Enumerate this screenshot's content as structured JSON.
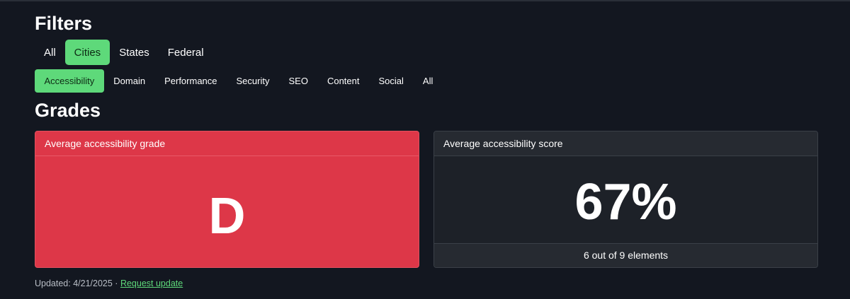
{
  "filters": {
    "title": "Filters",
    "scope_tabs": [
      {
        "label": "All",
        "active": false
      },
      {
        "label": "Cities",
        "active": true
      },
      {
        "label": "States",
        "active": false
      },
      {
        "label": "Federal",
        "active": false
      }
    ],
    "category_tabs": [
      {
        "label": "Accessibility",
        "active": true
      },
      {
        "label": "Domain",
        "active": false
      },
      {
        "label": "Performance",
        "active": false
      },
      {
        "label": "Security",
        "active": false
      },
      {
        "label": "SEO",
        "active": false
      },
      {
        "label": "Content",
        "active": false
      },
      {
        "label": "Social",
        "active": false
      },
      {
        "label": "All",
        "active": false
      }
    ]
  },
  "grades": {
    "title": "Grades",
    "grade_card": {
      "header": "Average accessibility grade",
      "value": "D"
    },
    "score_card": {
      "header": "Average accessibility score",
      "value": "67%",
      "footer": "6 out of 9 elements"
    }
  },
  "updated": {
    "text": "Updated: 4/21/2025 · ",
    "link_label": "Request update"
  },
  "colors": {
    "background": "#131720",
    "accent_green": "#5ed97a",
    "grade_red": "#dd3748",
    "card_dark": "#1d2128"
  }
}
